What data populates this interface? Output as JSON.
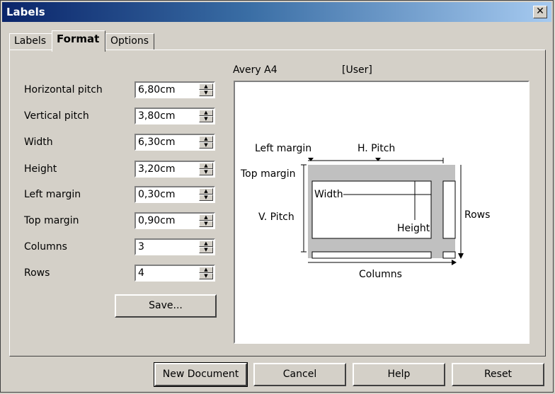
{
  "window": {
    "title": "Labels",
    "close_glyph": "✕"
  },
  "tabs": [
    {
      "label": "Labels"
    },
    {
      "label": "Format"
    },
    {
      "label": "Options"
    }
  ],
  "fields": [
    {
      "label": "Horizontal pitch",
      "value": "6,80cm"
    },
    {
      "label": "Vertical pitch",
      "value": "3,80cm"
    },
    {
      "label": "Width",
      "value": "6,30cm"
    },
    {
      "label": "Height",
      "value": "3,20cm"
    },
    {
      "label": "Left margin",
      "value": "0,30cm"
    },
    {
      "label": "Top margin",
      "value": "0,90cm"
    },
    {
      "label": "Columns",
      "value": "3"
    },
    {
      "label": "Rows",
      "value": "4"
    }
  ],
  "save_button": "Save...",
  "preview": {
    "brand": "Avery A4",
    "type": "[User]",
    "labels": {
      "left_margin": "Left margin",
      "h_pitch": "H. Pitch",
      "top_margin": "Top margin",
      "width": "Width",
      "v_pitch": "V. Pitch",
      "height": "Height",
      "rows": "Rows",
      "columns": "Columns"
    }
  },
  "footer": {
    "new_document": "New Document",
    "cancel": "Cancel",
    "help": "Help",
    "reset": "Reset"
  },
  "icons": {
    "spin_up": "▲",
    "spin_down": "▼"
  }
}
